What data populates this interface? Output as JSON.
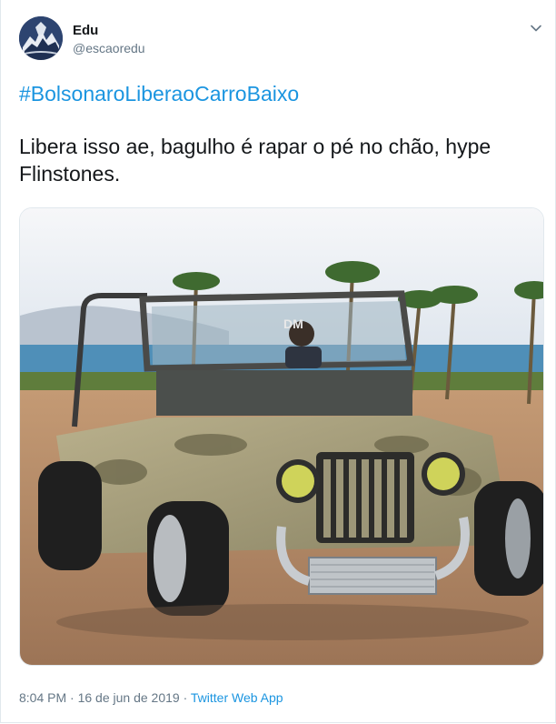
{
  "author": {
    "name": "Edu",
    "handle": "@escaoredu"
  },
  "tweet": {
    "hashtag": "#BolsonaroLiberaoCarroBaixo",
    "text": "Libera isso ae, bagulho é rapar o pé no chão, hype Flinstones."
  },
  "media": {
    "plate_text": "DM"
  },
  "meta": {
    "time": "8:04 PM",
    "separator": " · ",
    "date": "16 de jun de 2019",
    "app": "Twitter Web App"
  },
  "icons": {
    "menu": "chevron-down-icon"
  },
  "colors": {
    "link": "#1b95e0",
    "secondary": "#657786",
    "text": "#14171a",
    "border": "#e1e8ed"
  }
}
